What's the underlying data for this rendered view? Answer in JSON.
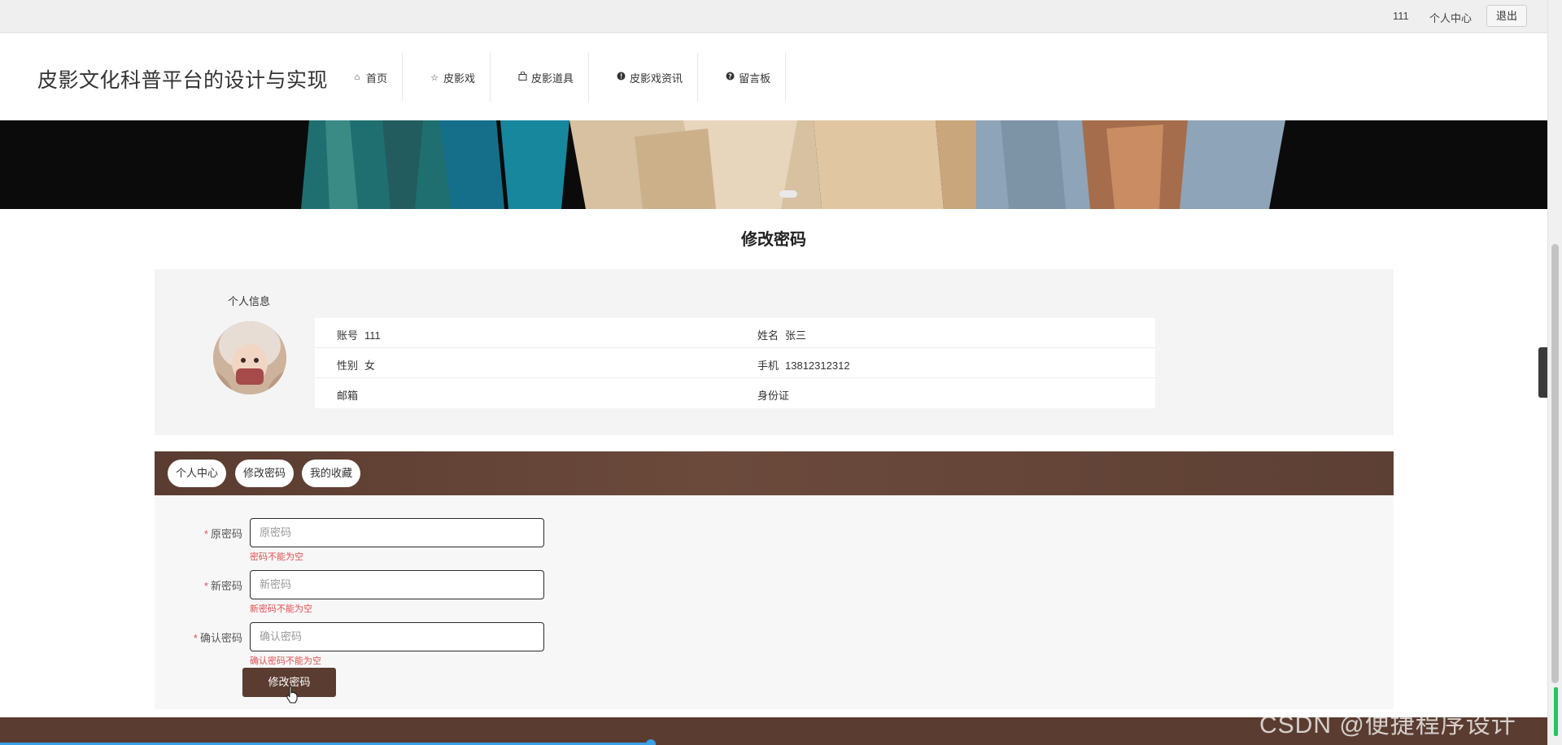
{
  "topbar": {
    "username": "111",
    "personal_center": "个人中心",
    "logout": "退出"
  },
  "header": {
    "site_title": "皮影文化科普平台的设计与实现",
    "nav": [
      {
        "label": "首页",
        "icon": "home-icon"
      },
      {
        "label": "皮影戏",
        "icon": "star-icon"
      },
      {
        "label": "皮影道具",
        "icon": "bag-icon"
      },
      {
        "label": "皮影戏资讯",
        "icon": "info-icon"
      },
      {
        "label": "留言板",
        "icon": "question-icon"
      }
    ]
  },
  "page_title": "修改密码",
  "profile": {
    "section_label": "个人信息",
    "rows": [
      {
        "k1": "账号",
        "v1": "111",
        "k2": "姓名",
        "v2": "张三"
      },
      {
        "k1": "性别",
        "v1": "女",
        "k2": "手机",
        "v2": "13812312312"
      },
      {
        "k1": "邮箱",
        "v1": "",
        "k2": "身份证",
        "v2": ""
      }
    ]
  },
  "tabs": [
    "个人中心",
    "修改密码",
    "我的收藏"
  ],
  "form": {
    "fields": [
      {
        "label": "原密码",
        "placeholder": "原密码",
        "error": "密码不能为空"
      },
      {
        "label": "新密码",
        "placeholder": "新密码",
        "error": "新密码不能为空"
      },
      {
        "label": "确认密码",
        "placeholder": "确认密码",
        "error": "确认密码不能为空"
      }
    ],
    "submit_label": "修改密码"
  },
  "watermark": "CSDN @便捷程序设计",
  "colors": {
    "brand_brown": "#5a3c30",
    "error_red": "#e05050",
    "loader_blue": "#3aa0e8"
  }
}
